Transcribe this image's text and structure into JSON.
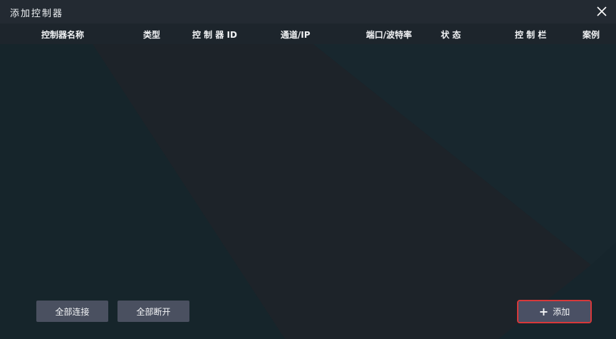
{
  "window": {
    "title": "添加控制器",
    "close_icon": "close-icon"
  },
  "table": {
    "columns": [
      "控制器名称",
      "类型",
      "控 制 器 ID",
      "通道/IP",
      "端口/波特率",
      "状 态",
      "控 制 栏",
      "案例"
    ],
    "rows": []
  },
  "footer": {
    "connect_all_label": "全部连接",
    "disconnect_all_label": "全部断开",
    "add_label": "添加",
    "add_icon": "plus-icon"
  },
  "colors": {
    "background": "#16252c",
    "titlebar": "#232a32",
    "button": "#4a5060",
    "highlight": "#d8383a"
  }
}
